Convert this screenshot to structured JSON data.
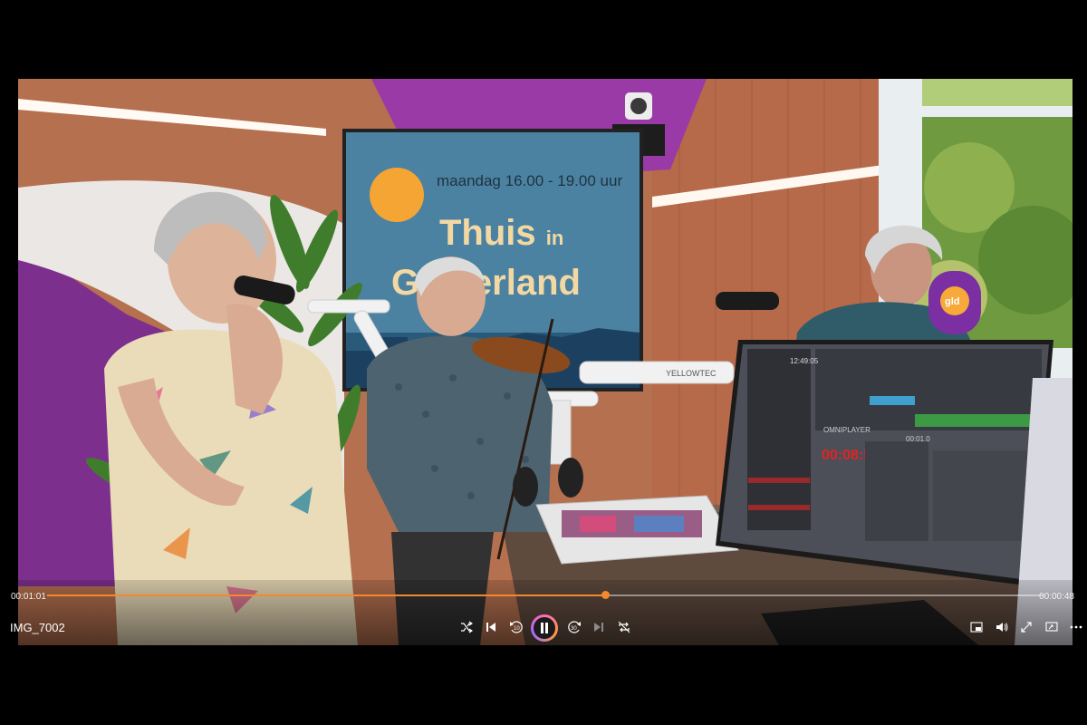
{
  "player": {
    "file_title": "IMG_7002",
    "elapsed": "00:01:01",
    "remaining": "00:00:48",
    "progress_fraction": 0.56,
    "accent_color": "#f28a2d"
  },
  "scene": {
    "tv_day_text": "maandag",
    "tv_hours_text": "16.00 - 19.00 uur",
    "tv_title_line1": "Thuis",
    "tv_title_in": "in",
    "tv_title_line2": "Gelderland",
    "mic_flag_text": "gld",
    "arm_brand_text": "YELLOWTEC",
    "monitor_time_text": "12:49:05",
    "countdown_text": "00:08:55",
    "omniplayer_text": "OMNIPLAYER",
    "monitor_clock_text": "00:01.0"
  },
  "controls": {
    "icons": [
      "shuffle-icon",
      "previous-icon",
      "rewind-10-icon",
      "pause-icon",
      "forward-30-icon",
      "next-icon",
      "repeat-icon",
      "miniplayer-icon",
      "volume-icon",
      "fullscreen-icon",
      "cast-icon",
      "more-icon"
    ]
  }
}
